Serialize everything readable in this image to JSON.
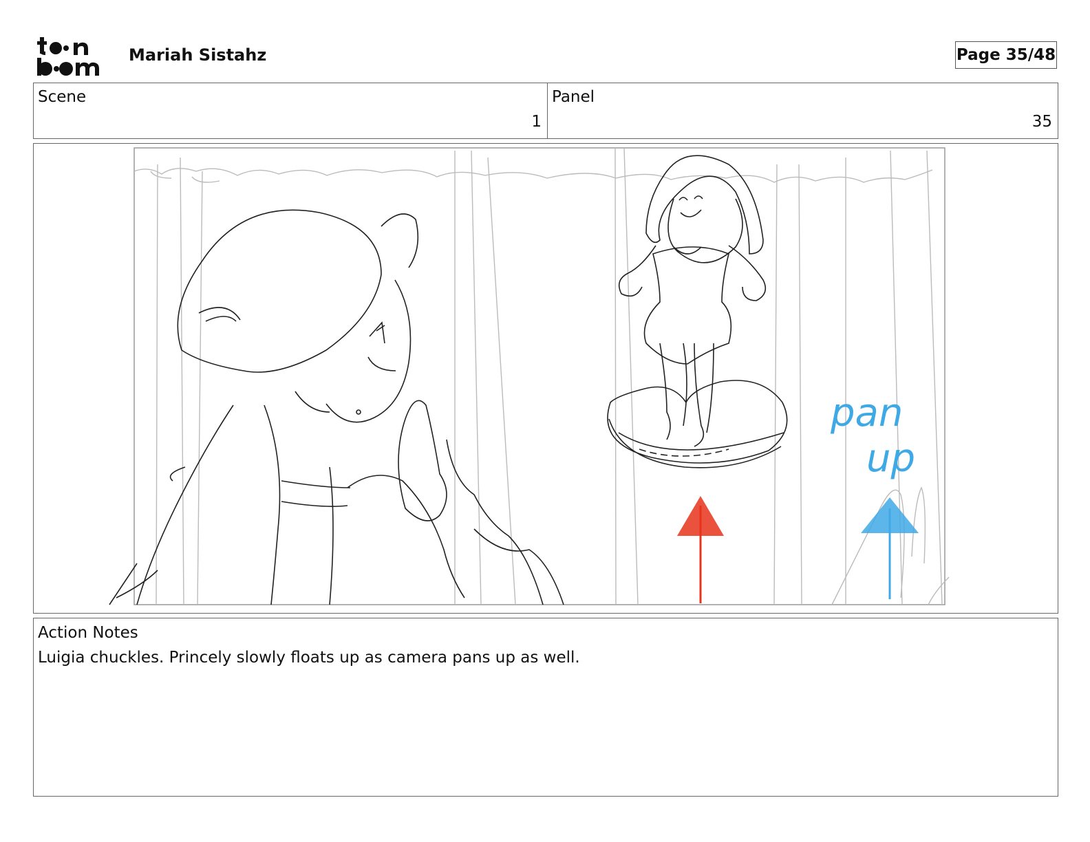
{
  "header": {
    "logo_text": "toon boom",
    "project_title": "Mariah Sistahz",
    "page_label": "Page 35/48"
  },
  "info": {
    "scene_label": "Scene",
    "scene_value": "1",
    "panel_label": "Panel",
    "panel_value": "35"
  },
  "sketch": {
    "annotation_text": "pan up",
    "colors": {
      "pencil": "#222222",
      "light_pencil": "#b8b8b8",
      "red_arrow": "#e8341c",
      "blue_arrow": "#3fa9e6"
    }
  },
  "notes": {
    "label": "Action Notes",
    "text": "Luigia chuckles. Princely slowly floats up as camera pans up as well."
  }
}
